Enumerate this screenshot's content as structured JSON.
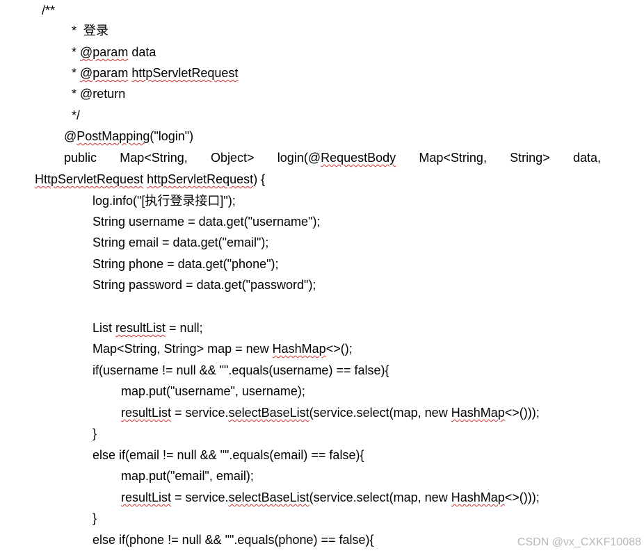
{
  "comment": {
    "open": "/**",
    "title": "*  登录",
    "param_prefix": "* ",
    "param_tag": "@param",
    "param1_name": " data",
    "param2_name": "httpServletRequest",
    "return_line": "* @return",
    "close": "*/"
  },
  "annotation": {
    "at": "@",
    "name": "PostMapping",
    "args": "(\"login\")"
  },
  "signature": {
    "tokens": [
      "public",
      "Map<String,",
      "Object>",
      "login(@RequestBody",
      "Map<String,",
      "String>",
      "data,"
    ],
    "login_prefix": "login(@",
    "request_body": "RequestBody",
    "cont_type": "HttpServletRequest",
    "cont_name": "httpServletRequest",
    "cont_tail": ") {"
  },
  "body": {
    "log": "log.info(\"[执行登录接口]\");",
    "username": "String username = data.get(\"username\");",
    "email": "String email = data.get(\"email\");",
    "phone": "String phone = data.get(\"phone\");",
    "password": "String password = data.get(\"password\");",
    "list_a": "List ",
    "result_list": "resultList",
    "list_b": " = null;",
    "map_a": "Map<String, String> map = new ",
    "hashmap": "HashMap",
    "map_b": "<>();",
    "if_username": "if(username != null && \"\".equals(username) == false){",
    "put_username": "map.put(\"username\", username);",
    "assign_mid": " = service.",
    "select_base_list": "selectBaseList",
    "select_call": "(service.select(map, new ",
    "select_tail": "<>()));",
    "close_brace": "}",
    "elseif_email": "else if(email != null && \"\".equals(email) == false){",
    "put_email": "map.put(\"email\", email);",
    "elseif_phone": "else if(phone != null && \"\".equals(phone) == false){"
  },
  "watermark": "CSDN @vx_CXKF10088"
}
